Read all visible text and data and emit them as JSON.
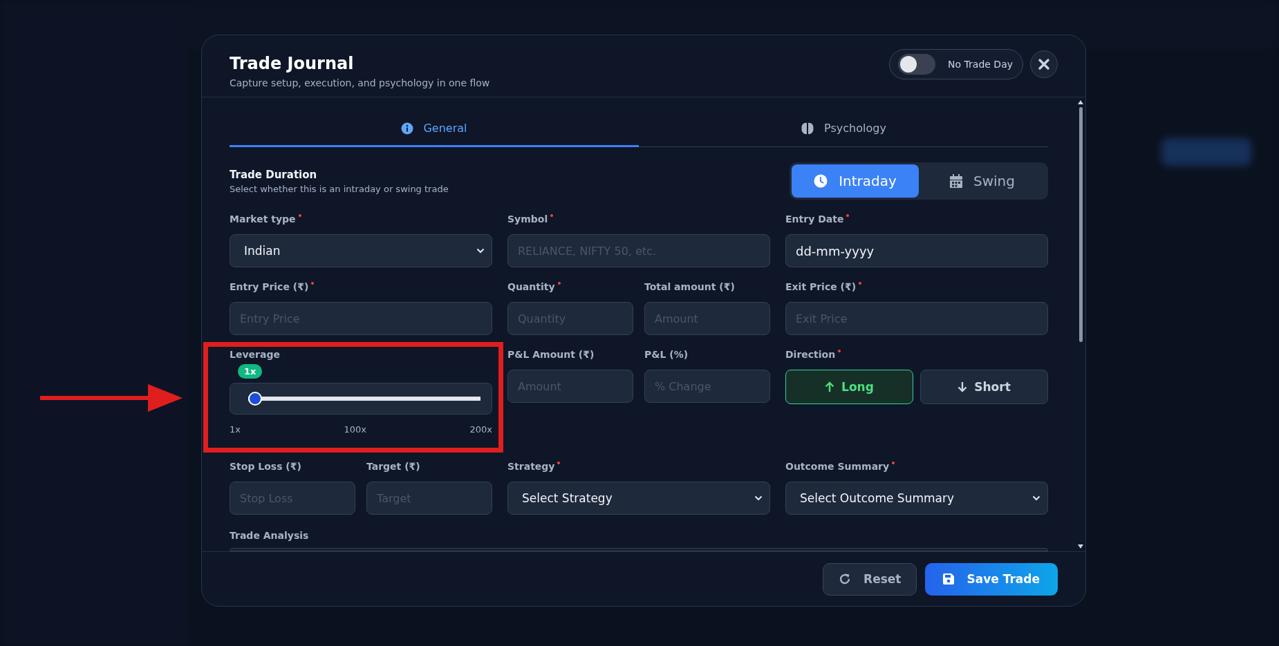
{
  "window": {
    "title": "Trade Journal",
    "subtitle": "Capture setup, execution, and psychology in one flow"
  },
  "no_trade_day": {
    "label": "No Trade Day",
    "on": false
  },
  "tabs": [
    {
      "label": "General",
      "selected": true,
      "kind": "info"
    },
    {
      "label": "Psychology",
      "selected": false,
      "kind": "brain"
    }
  ],
  "duration": {
    "title": "Trade Duration",
    "description": "Select whether this is an intraday or swing trade",
    "options": [
      {
        "label": "Intraday",
        "selected": true,
        "kind": "clock"
      },
      {
        "label": "Swing",
        "selected": false,
        "kind": "calendar"
      }
    ]
  },
  "rows": [
    [
      [
        {
          "kind": "select",
          "label": "Market type",
          "required": true,
          "value": "Indian"
        }
      ],
      [
        {
          "kind": "input",
          "label": "Symbol",
          "required": true,
          "placeholder": "RELIANCE, NIFTY 50, etc."
        }
      ],
      [
        {
          "kind": "input",
          "label": "Entry Date",
          "required": true,
          "value": "dd-mm-yyyy"
        }
      ]
    ],
    [
      [
        {
          "kind": "input",
          "label": "Entry Price (₹)",
          "required": true,
          "placeholder": "Entry Price"
        }
      ],
      [
        {
          "kind": "input",
          "label": "Quantity",
          "required": true,
          "placeholder": "Quantity"
        },
        {
          "kind": "input",
          "label": "Total amount (₹)",
          "required": false,
          "placeholder": "Amount"
        }
      ],
      [
        {
          "kind": "input",
          "label": "Exit Price (₹)",
          "required": true,
          "placeholder": "Exit Price"
        }
      ]
    ],
    [
      [
        {
          "kind": "slider",
          "label": "Leverage",
          "required": false,
          "badge": "1x",
          "level": 0,
          "ticks": [
            "1x",
            "100x",
            "200x"
          ]
        }
      ],
      [
        {
          "kind": "input",
          "label": "P&L Amount (₹)",
          "required": false,
          "placeholder": "Amount"
        },
        {
          "kind": "input",
          "label": "P&L (%)",
          "required": false,
          "placeholder": "% Change"
        }
      ],
      [
        {
          "kind": "direction",
          "label": "Direction",
          "required": true,
          "options": [
            {
              "label": "Long",
              "selected": true,
              "kind": "up"
            },
            {
              "label": "Short",
              "selected": false,
              "kind": "down"
            }
          ]
        }
      ]
    ],
    [
      [
        {
          "kind": "input",
          "label": "Stop Loss (₹)",
          "required": false,
          "placeholder": "Stop Loss"
        },
        {
          "kind": "input",
          "label": "Target (₹)",
          "required": false,
          "placeholder": "Target"
        }
      ],
      [
        {
          "kind": "select",
          "label": "Strategy",
          "required": true,
          "value": "Select Strategy"
        }
      ],
      [
        {
          "kind": "select",
          "label": "Outcome Summary",
          "required": true,
          "value": "Select Outcome Summary"
        }
      ]
    ]
  ],
  "trade_analysis": {
    "label": "Trade Analysis"
  },
  "footer": {
    "buttons": [
      {
        "label": "Reset",
        "kind": "reset"
      },
      {
        "label": "Save Trade",
        "kind": "save"
      }
    ]
  },
  "annotations": {
    "highlight_frame": true,
    "pointer_arrow": true
  }
}
